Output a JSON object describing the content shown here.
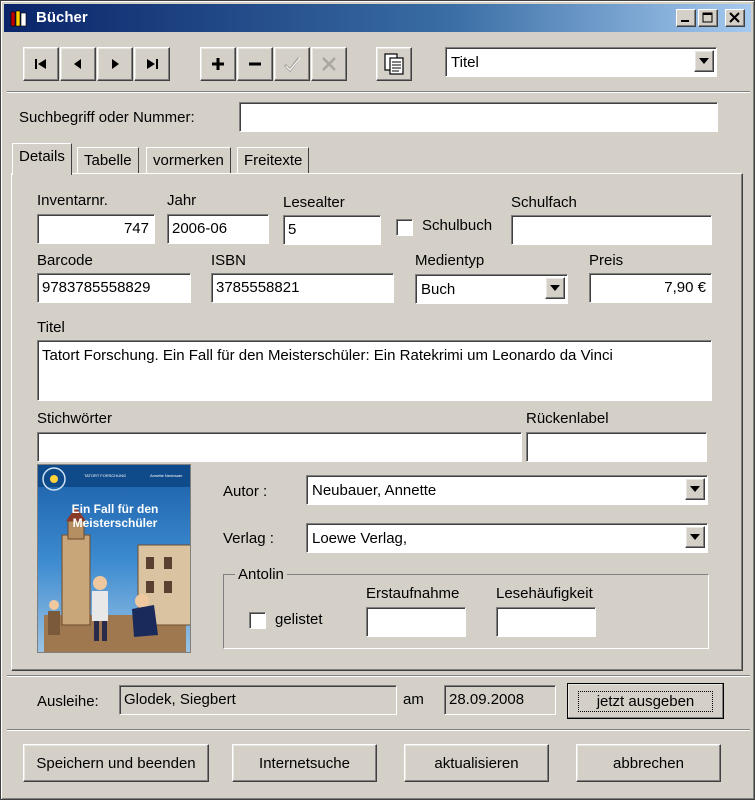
{
  "window": {
    "title": "Bücher"
  },
  "toolbar": {
    "search_field_combo": "Titel"
  },
  "search": {
    "label": "Suchbegriff oder Nummer:",
    "value": ""
  },
  "tabs": [
    {
      "label": "Details",
      "active": true
    },
    {
      "label": "Tabelle",
      "active": false
    },
    {
      "label": "vormerken",
      "active": false
    },
    {
      "label": "Freitexte",
      "active": false
    }
  ],
  "details": {
    "inventar_label": "Inventarnr.",
    "inventar_value": "747",
    "jahr_label": "Jahr",
    "jahr_value": "2006-06",
    "lesealter_label": "Lesealter",
    "lesealter_value": "5",
    "schulbuch_label": "Schulbuch",
    "schulbuch_checked": false,
    "schulfach_label": "Schulfach",
    "schulfach_value": "",
    "barcode_label": "Barcode",
    "barcode_value": "9783785558829",
    "isbn_label": "ISBN",
    "isbn_value": "3785558821",
    "medientyp_label": "Medientyp",
    "medientyp_value": "Buch",
    "preis_label": "Preis",
    "preis_value": "7,90 €",
    "titel_label": "Titel",
    "titel_value": "Tatort Forschung. Ein Fall für den Meisterschüler: Ein Ratekrimi um Leonardo da Vinci",
    "stichwoerter_label": "Stichwörter",
    "stichwoerter_value": "",
    "rueckenlabel_label": "Rückenlabel",
    "rueckenlabel_value": "",
    "autor_label": "Autor :",
    "autor_value": "Neubauer, Annette",
    "verlag_label": "Verlag :",
    "verlag_value": "Loewe Verlag,",
    "antolin": {
      "group_label": "Antolin",
      "gelistet_label": "gelistet",
      "gelistet_checked": false,
      "erstaufnahme_label": "Erstaufnahme",
      "erstaufnahme_value": "",
      "lesehaeufigkeit_label": "Lesehäufigkeit",
      "lesehaeufigkeit_value": ""
    },
    "cover": {
      "series": "TATORT FORSCHUNG",
      "title_line1": "Ein Fall für den",
      "title_line2": "Meisterschüler",
      "author": "Annette Neubauer"
    }
  },
  "loan": {
    "label": "Ausleihe:",
    "borrower": "Glodek, Siegbert",
    "am_label": "am",
    "date": "28.09.2008",
    "issue_button": "jetzt ausgeben"
  },
  "footer": {
    "save_button": "Speichern und beenden",
    "internet_button": "Internetsuche",
    "refresh_button": "aktualisieren",
    "cancel_button": "abbrechen"
  },
  "colors": {
    "title_bar": "#0a246a",
    "face": "#d4d0c8",
    "cover_blue": "#1e6fb0"
  }
}
